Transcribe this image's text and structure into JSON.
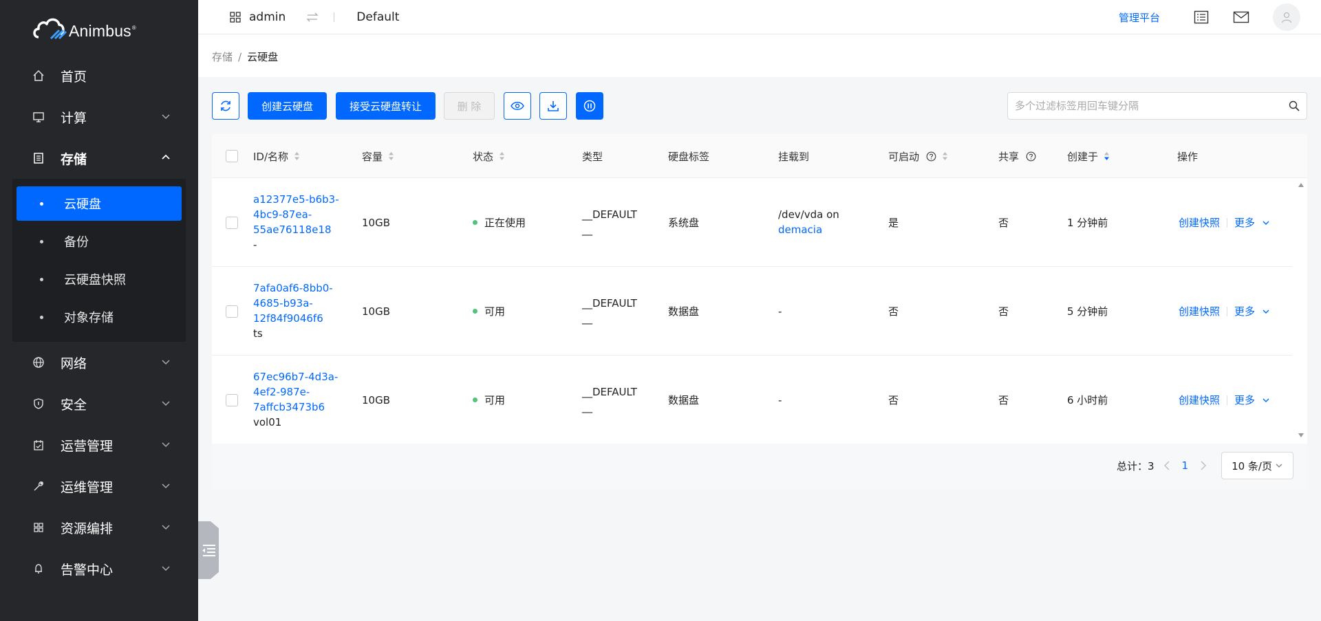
{
  "brand": {
    "name": "Animbus",
    "mark": "®"
  },
  "sidebar": {
    "items": [
      {
        "label": "首页",
        "icon": "home-icon"
      },
      {
        "label": "计算",
        "icon": "monitor-icon"
      },
      {
        "label": "存储",
        "icon": "storage-icon"
      },
      {
        "label": "网络",
        "icon": "globe-icon"
      },
      {
        "label": "安全",
        "icon": "shield-icon"
      },
      {
        "label": "运营管理",
        "icon": "calendar-icon"
      },
      {
        "label": "运维管理",
        "icon": "wrench-icon"
      },
      {
        "label": "资源编排",
        "icon": "grid-icon"
      },
      {
        "label": "告警中心",
        "icon": "bell-icon"
      }
    ],
    "storage_sub": [
      {
        "label": "云硬盘"
      },
      {
        "label": "备份"
      },
      {
        "label": "云硬盘快照"
      },
      {
        "label": "对象存储"
      }
    ]
  },
  "header": {
    "user": "admin",
    "project": "Default",
    "admin_link": "管理平台"
  },
  "breadcrumb": {
    "parent": "存储",
    "sep": "/",
    "current": "云硬盘"
  },
  "toolbar": {
    "create": "创建云硬盘",
    "accept_transfer": "接受云硬盘转让",
    "delete": "删 除",
    "search_placeholder": "多个过滤标签用回车键分隔"
  },
  "table": {
    "headers": {
      "id": "ID/名称",
      "size": "容量",
      "status": "状态",
      "type": "类型",
      "tag": "硬盘标签",
      "attach": "挂载到",
      "bootable": "可启动",
      "shared": "共享",
      "created": "创建于",
      "ops": "操作"
    },
    "rows": [
      {
        "id1": "a12377e5-b6b3-",
        "id2": "4bc9-87ea-",
        "id3": "55ae76118e18",
        "name": "-",
        "size": "10GB",
        "status": "正在使用",
        "type1": "__DEFAULT",
        "type2": "__",
        "tag": "系统盘",
        "attach1": "/dev/vda on",
        "attach2": "demacia",
        "bootable": "是",
        "shared": "否",
        "created": "1 分钟前",
        "op1": "创建快照",
        "op2": "更多"
      },
      {
        "id1": "7afa0af6-8bb0-",
        "id2": "4685-b93a-",
        "id3": "12f84f9046f6",
        "name": "ts",
        "size": "10GB",
        "status": "可用",
        "type1": "__DEFAULT",
        "type2": "__",
        "tag": "数据盘",
        "attach1": "-",
        "attach2": "",
        "bootable": "否",
        "shared": "否",
        "created": "5 分钟前",
        "op1": "创建快照",
        "op2": "更多"
      },
      {
        "id1": "67ec96b7-4d3a-",
        "id2": "4ef2-987e-",
        "id3": "7affcb3473b6",
        "name": "vol01",
        "size": "10GB",
        "status": "可用",
        "type1": "__DEFAULT",
        "type2": "__",
        "tag": "数据盘",
        "attach1": "-",
        "attach2": "",
        "bootable": "否",
        "shared": "否",
        "created": "6 小时前",
        "op1": "创建快照",
        "op2": "更多"
      }
    ]
  },
  "pager": {
    "total_label": "总计：3",
    "page": "1",
    "page_size": "10 条/页"
  }
}
